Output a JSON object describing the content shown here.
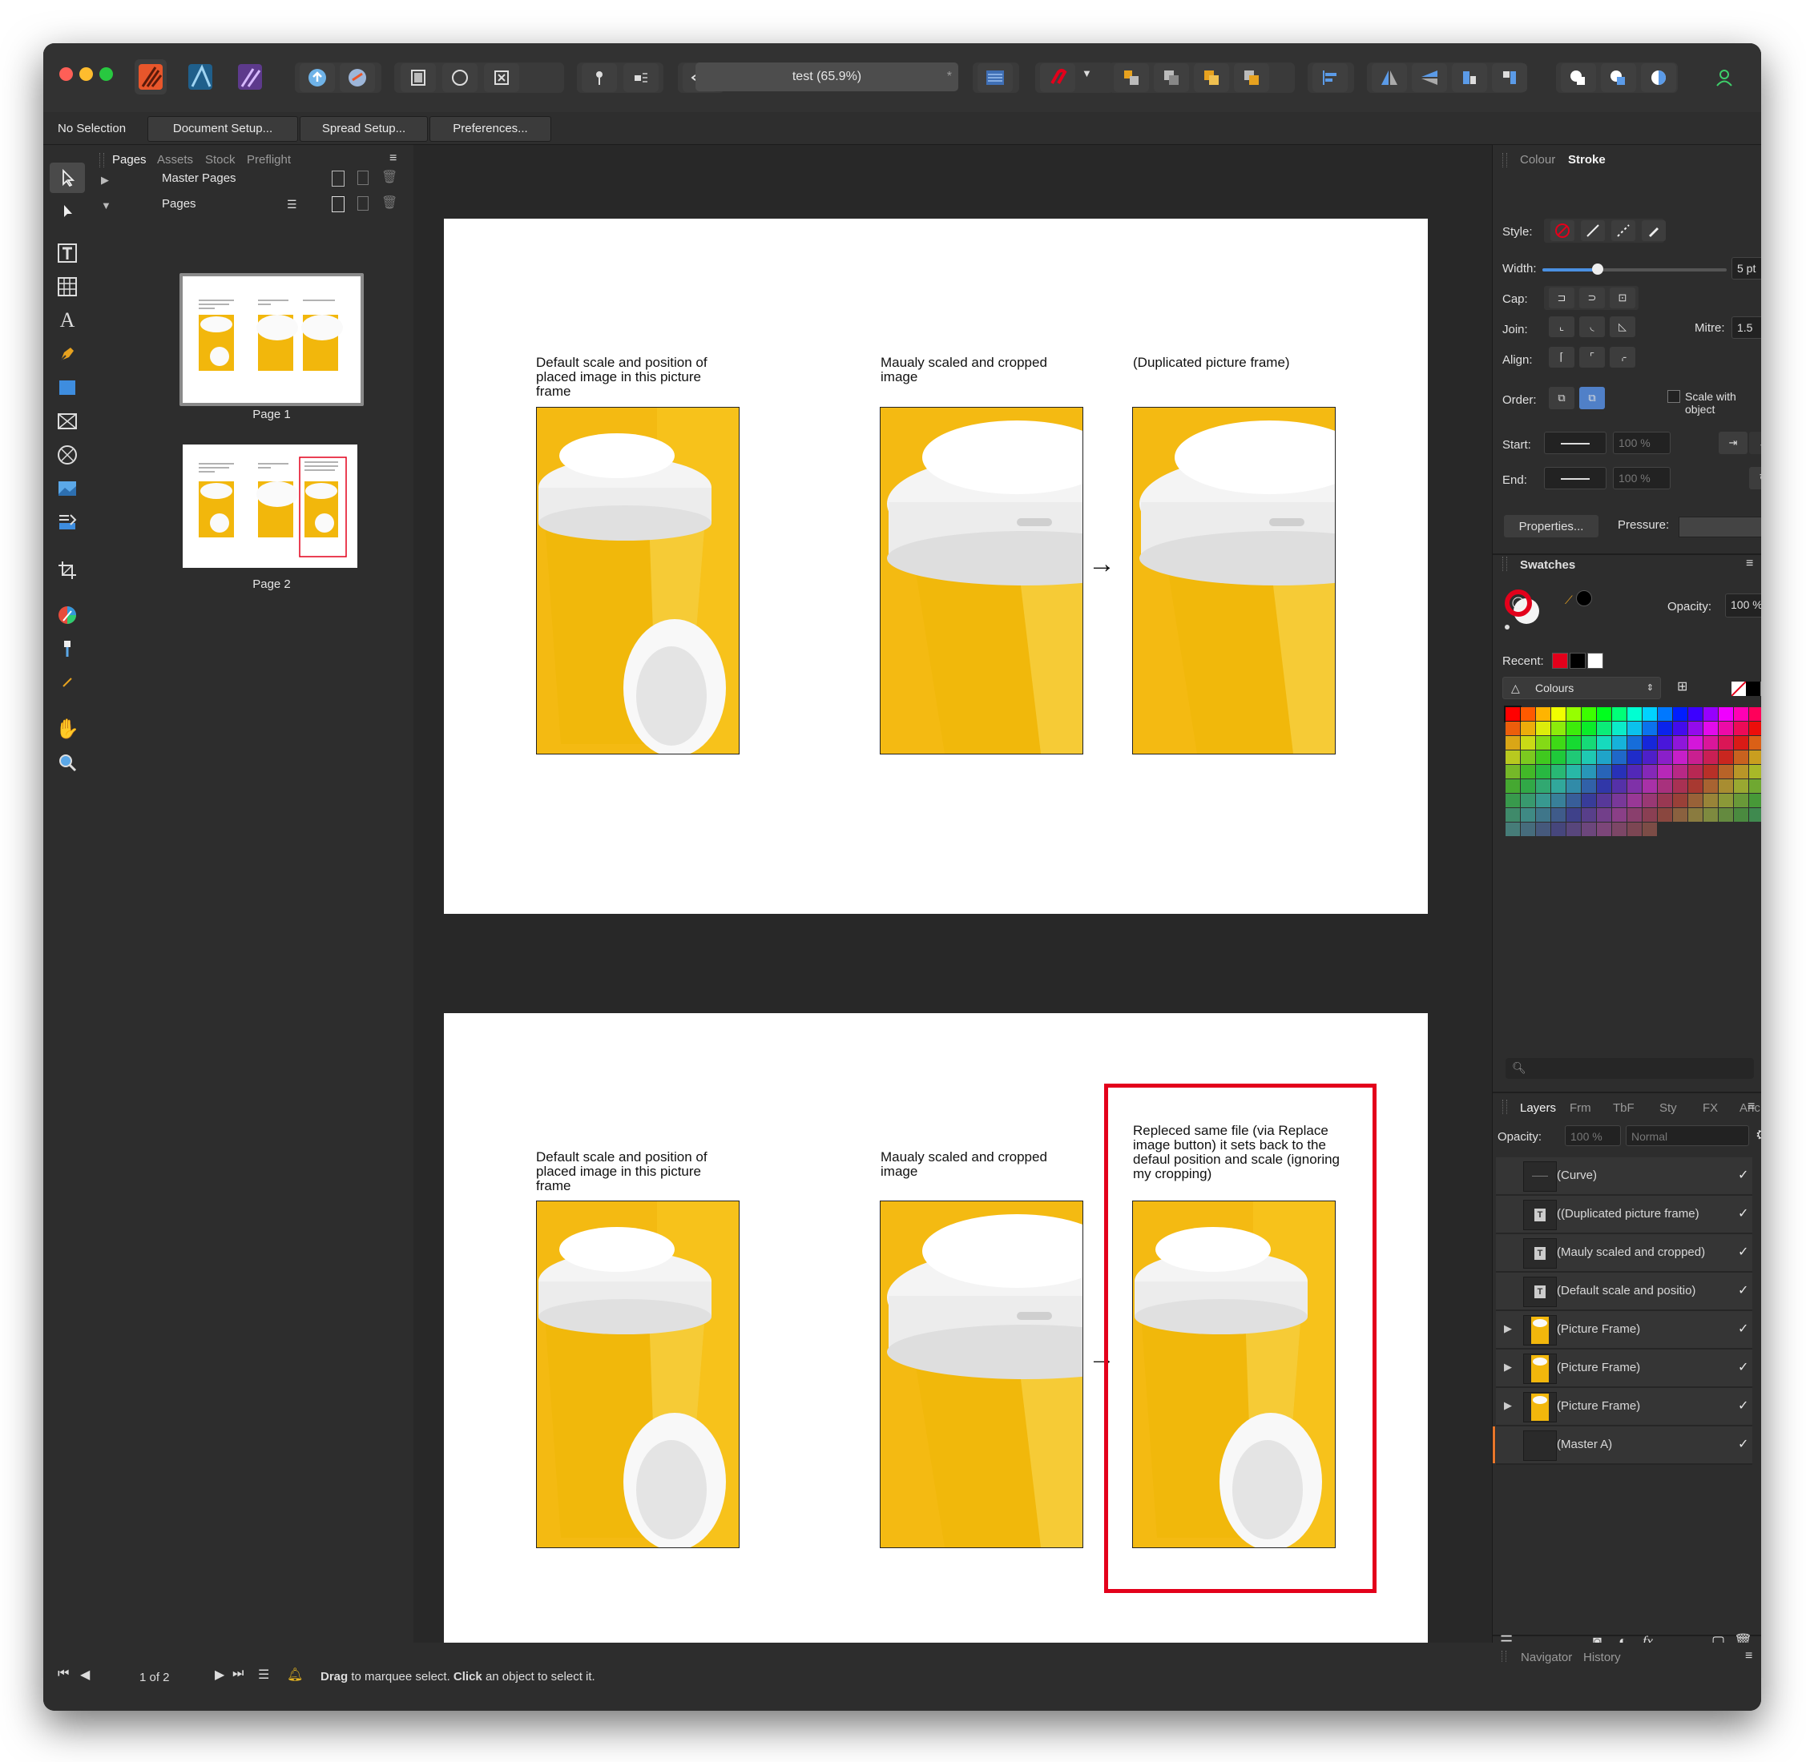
{
  "window": {
    "traffic_lights": [
      "#ff5f57",
      "#febc2e",
      "#28c840"
    ]
  },
  "toolbar": {
    "document_title": "test (65.9%)",
    "title_star": "*"
  },
  "context_toolbar": {
    "selection_status": "No Selection",
    "document_setup": "Document Setup...",
    "spread_setup": "Spread Setup...",
    "preferences": "Preferences..."
  },
  "tools": [
    "move-tool-icon",
    "node-tool-icon",
    "text-frame-tool-icon",
    "table-tool-icon",
    "artistic-text-tool-icon",
    "pen-tool-icon",
    "rectangle-tool-icon",
    "picture-frame-tool-icon",
    "ellipse-frame-tool-icon",
    "place-image-tool-icon",
    "vector-crop-tool-icon",
    "color-picker-tool-icon",
    "fill-tool-icon",
    "transparency-tool-icon",
    "hand-tool-icon",
    "zoom-tool-icon"
  ],
  "pages_panel": {
    "tabs": [
      "Pages",
      "Assets",
      "Stock",
      "Preflight"
    ],
    "master_pages_label": "Master Pages",
    "pages_label": "Pages",
    "page1_label": "Page 1",
    "page2_label": "Page 2"
  },
  "document": {
    "page1": {
      "caption1": "Default scale and position of placed image in this picture frame",
      "caption2": "Maualy scaled and cropped image",
      "caption3": "(Duplicated picture frame)"
    },
    "page2": {
      "caption1": "Default scale and position of placed image in this picture frame",
      "caption2": "Maualy scaled and cropped image",
      "caption3": "Repleced same file (via Replace image button) it sets back to the defaul position and scale (ignoring my cropping)"
    },
    "arrow": "→",
    "highlight_color": "#e3001b"
  },
  "stroke_panel": {
    "tabs": [
      "Colour",
      "Stroke"
    ],
    "active_tab": "Stroke",
    "style_label": "Style:",
    "width_label": "Width:",
    "width_value": "5 pt",
    "width_slider_fraction": 0.3,
    "cap_label": "Cap:",
    "join_label": "Join:",
    "mitre_label": "Mitre:",
    "mitre_value": "1.5",
    "align_label": "Align:",
    "order_label": "Order:",
    "scale_with_object": "Scale with object",
    "start_label": "Start:",
    "start_pct": "100 %",
    "end_label": "End:",
    "end_pct": "100 %",
    "properties_button": "Properties...",
    "pressure_label": "Pressure:"
  },
  "swatches_panel": {
    "title": "Swatches",
    "opacity_label": "Opacity:",
    "opacity_value": "100 %",
    "recent_label": "Recent:",
    "recent_colors": [
      "#e3001b",
      "#000000",
      "#ffffff"
    ],
    "palette_name": "Colours"
  },
  "layers_panel": {
    "tabs": [
      "Layers",
      "Frm",
      "TbF",
      "Sty",
      "FX",
      "Anc"
    ],
    "opacity_label": "Opacity:",
    "opacity_value": "100 %",
    "blend_mode": "Normal",
    "rows": [
      {
        "label": "(Curve)",
        "thumb": "curve",
        "expand": ""
      },
      {
        "label": "((Duplicated picture frame)",
        "thumb": "text",
        "expand": ""
      },
      {
        "label": "(Mauly scaled and cropped)",
        "thumb": "text",
        "expand": ""
      },
      {
        "label": "(Default scale and positio)",
        "thumb": "text",
        "expand": ""
      },
      {
        "label": "(Picture Frame)",
        "thumb": "image",
        "expand": "▶"
      },
      {
        "label": "(Picture Frame)",
        "thumb": "image",
        "expand": "▶"
      },
      {
        "label": "(Picture Frame)",
        "thumb": "image",
        "expand": "▶"
      },
      {
        "label": "(Master A)",
        "thumb": "blank",
        "expand": ""
      }
    ],
    "check_mark": "✓"
  },
  "bottom_tabs": [
    "Navigator",
    "History"
  ],
  "status_bar": {
    "page_indicator": "1 of 2",
    "hint_drag": "Drag",
    "hint_drag_text": " to marquee select. ",
    "hint_click": "Click",
    "hint_click_text": " an object to select it."
  }
}
